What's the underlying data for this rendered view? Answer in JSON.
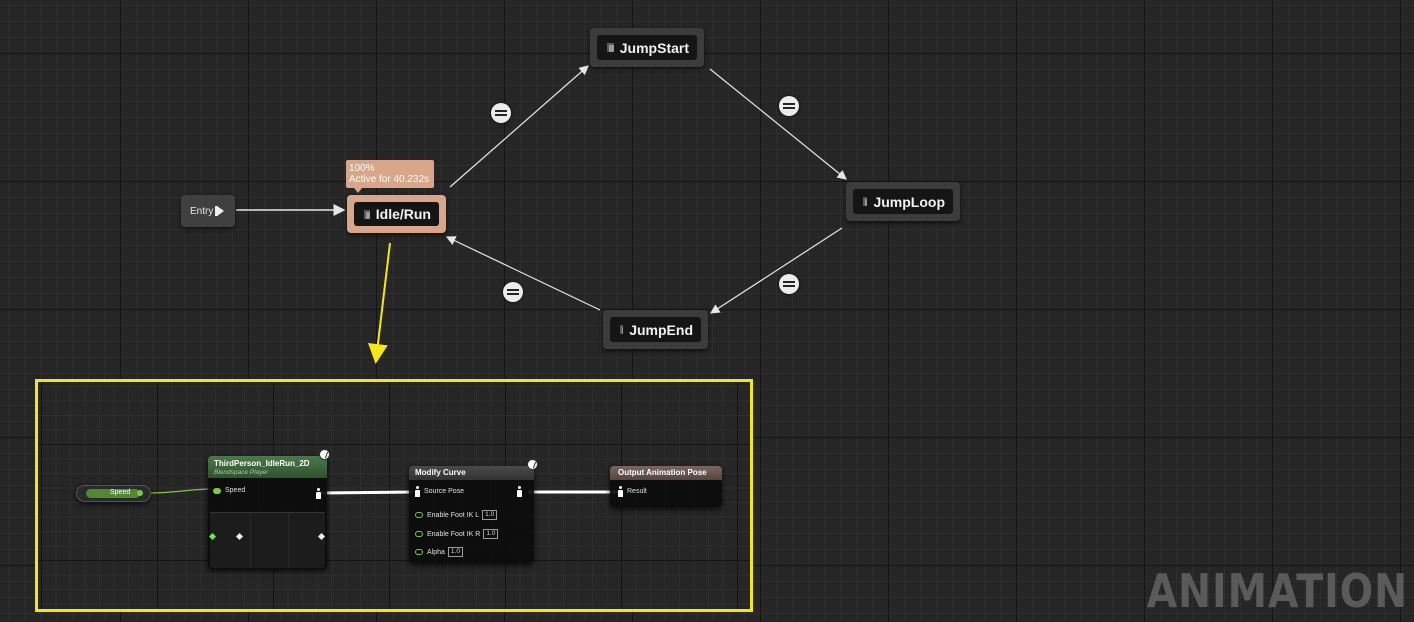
{
  "state_machine": {
    "entry_label": "Entry",
    "states": {
      "idle_run": "Idle/Run",
      "jump_start": "JumpStart",
      "jump_loop": "JumpLoop",
      "jump_end": "JumpEnd"
    },
    "active_tooltip": {
      "weight": "100%",
      "active_time": "Active for 40.232s"
    }
  },
  "blueprint": {
    "speed_variable": "Speed",
    "blendspace_node": {
      "title": "ThirdPerson_IdleRun_2D",
      "subtitle": "Blendspace Player",
      "input_pin": "Speed"
    },
    "modify_curve_node": {
      "title": "Modify Curve",
      "source_pin": "Source Pose",
      "params": [
        {
          "label": "Enable Foot IK L",
          "value": "1.0"
        },
        {
          "label": "Enable Foot IK R",
          "value": "1.0"
        },
        {
          "label": "Alpha",
          "value": "1.0"
        }
      ]
    },
    "output_node": {
      "title": "Output Animation Pose",
      "result_pin": "Result"
    }
  },
  "watermark": "ANIMATION",
  "colors": {
    "active_state": "#d9a68a",
    "highlight_box": "#f5e617",
    "blendspace_header": "#3c6a3c",
    "modify_curve_header": "#3f3f3f",
    "output_header": "#6b5a54",
    "float_pin": "#7ec64a"
  }
}
